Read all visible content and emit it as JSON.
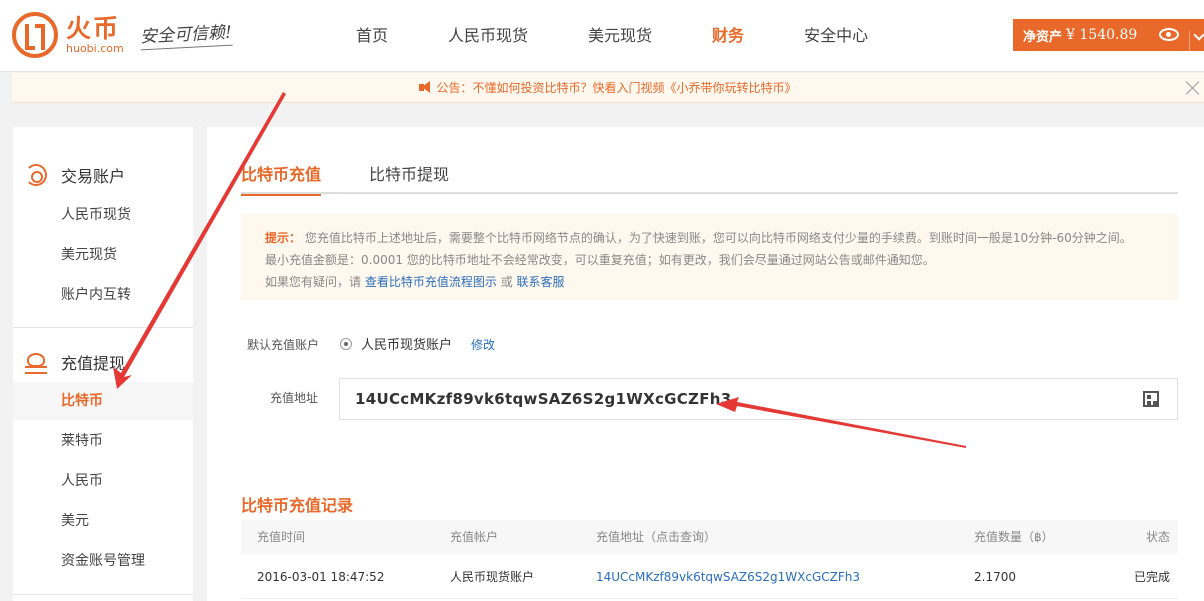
{
  "brand": {
    "name_cn": "火币",
    "name_en": "huobi.com",
    "slogan": "安全可信赖!"
  },
  "nav": {
    "items": [
      "首页",
      "人民币现货",
      "美元现货",
      "财务",
      "安全中心"
    ],
    "active_index": 3
  },
  "assets": {
    "label": "净资产",
    "value": "¥ 1540.89"
  },
  "notice": {
    "text": "公告：不懂如何投资比特币？快看入门视频《小乔带你玩转比特币》"
  },
  "sidebar": {
    "group1": {
      "title": "交易账户",
      "items": [
        "人民币现货",
        "美元现货",
        "账户内互转"
      ]
    },
    "group2": {
      "title": "充值提现",
      "items": [
        "比特币",
        "莱特币",
        "人民币",
        "美元",
        "资金账号管理"
      ],
      "active_index": 0
    }
  },
  "tabs": {
    "items": [
      "比特币充值",
      "比特币提现"
    ],
    "active_index": 0
  },
  "tip": {
    "label": "提示：",
    "line1": "您充值比特币上述地址后，需要整个比特币网络节点的确认，为了快速到账，您可以向比特币网络支付少量的手续费。到账时间一般是10分钟-60分钟之间。",
    "line2": "最小充值金额是：0.0001 您的比特币地址不会经常改变，可以重复充值；如有更改，我们会尽量通过网站公告或邮件通知您。",
    "line3_prefix": "如果您有疑问，请",
    "link1": "查看比特币充值流程图示",
    "or": "或",
    "link2": "联系客服"
  },
  "form": {
    "default_account_label": "默认充值账户",
    "default_account_value": "人民币现货账户",
    "edit_label": "修改",
    "address_label": "充值地址",
    "address_value": "14UCcMKzf89vk6tqwSAZ6S2g1WXcGCZFh3"
  },
  "records": {
    "title": "比特币充值记录",
    "columns": [
      "充值时间",
      "充值帐户",
      "充值地址（点击查询）",
      "充值数量（฿）",
      "状态"
    ],
    "rows": [
      {
        "time": "2016-03-01 18:47:52",
        "account": "人民币现货账户",
        "address": "14UCcMKzf89vk6tqwSAZ6S2g1WXcGCZFh3",
        "amount": "2.1700",
        "status": "已完成"
      }
    ]
  },
  "colors": {
    "accent": "#e8692a",
    "link": "#2a6ebb",
    "annotation": "#e53935"
  }
}
